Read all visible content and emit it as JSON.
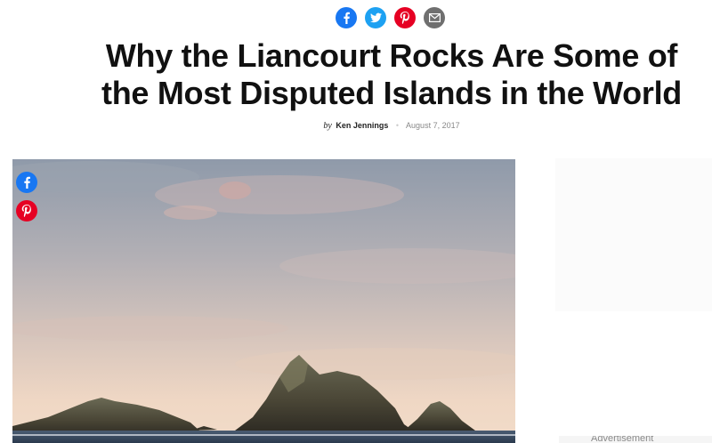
{
  "share_top": [
    {
      "network": "facebook",
      "icon": "facebook-icon",
      "color": "#1877f2"
    },
    {
      "network": "twitter",
      "icon": "twitter-icon",
      "color": "#1da1f2"
    },
    {
      "network": "pinterest",
      "icon": "pinterest-icon",
      "color": "#e60023"
    },
    {
      "network": "email",
      "icon": "mail-icon",
      "color": "#6f6f6f"
    }
  ],
  "article": {
    "title_line1": "Why the Liancourt Rocks Are Some of",
    "title_line2": "the Most Disputed Islands in the World",
    "by": "by",
    "author": "Ken Jennings",
    "date": "August 7, 2017"
  },
  "side_share": [
    {
      "network": "facebook",
      "icon": "facebook-icon"
    },
    {
      "network": "pinterest",
      "icon": "pinterest-icon"
    }
  ],
  "promo": {
    "text": "Advertisement"
  }
}
